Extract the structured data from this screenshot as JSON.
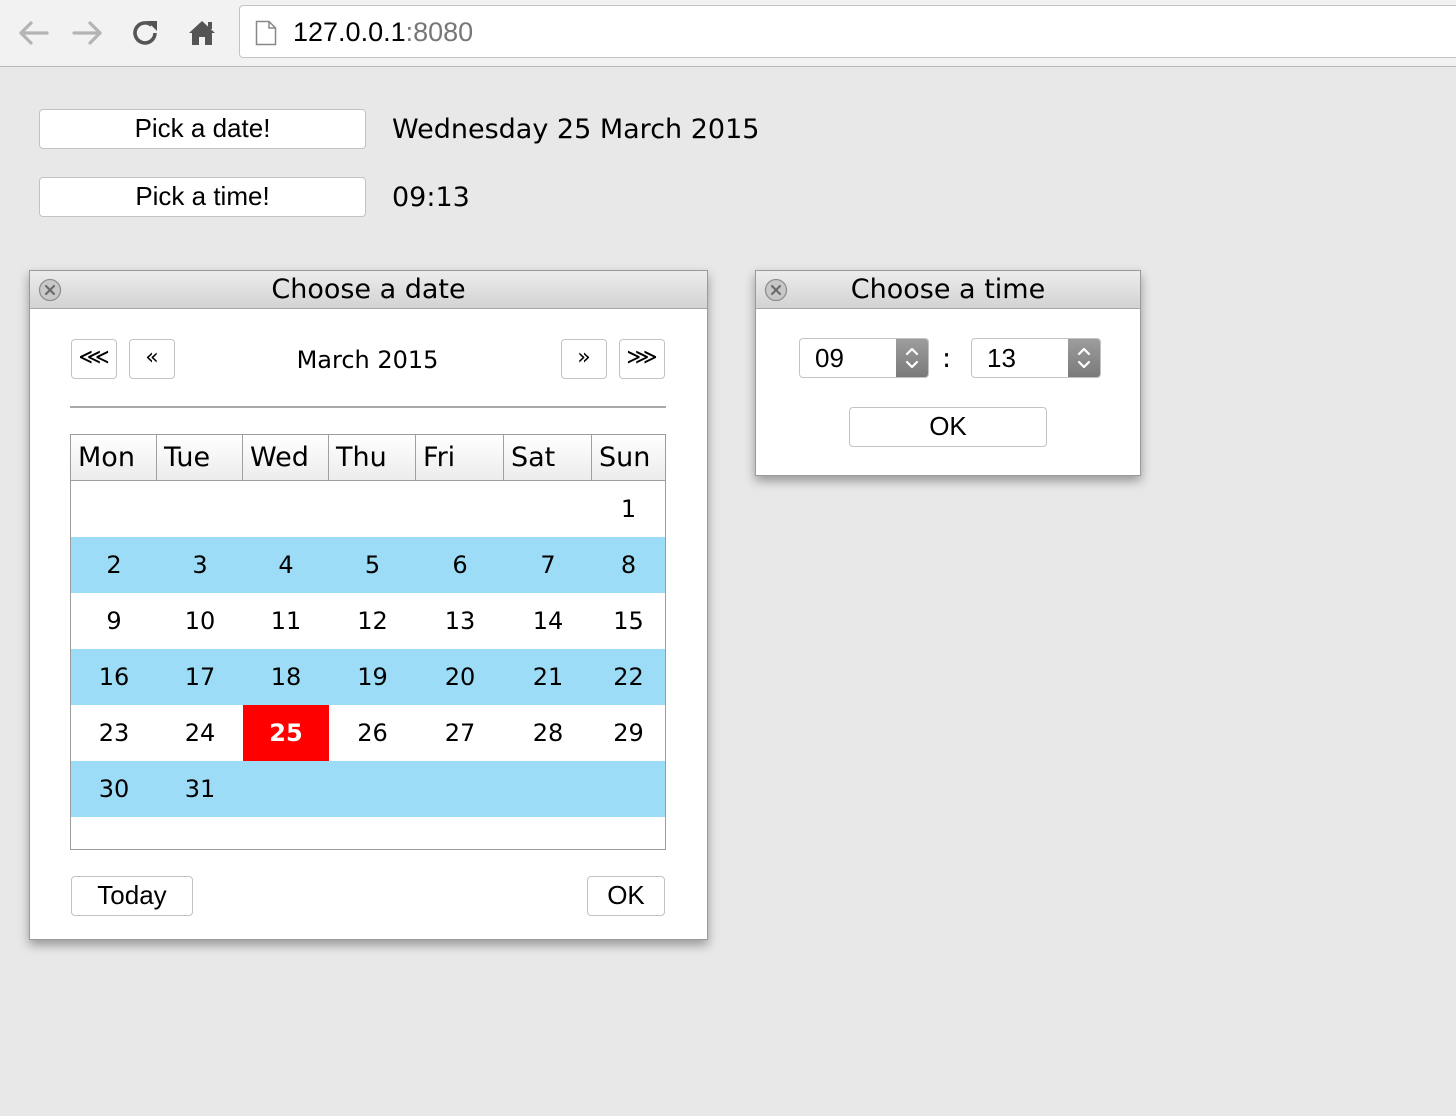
{
  "browser": {
    "url_host": "127.0.0.1",
    "url_port": ":8080",
    "icons": [
      "back-icon",
      "forward-icon",
      "reload-icon",
      "home-icon",
      "page-icon"
    ]
  },
  "page": {
    "date_button_label": "Pick a date!",
    "date_value": "Wednesday 25 March 2015",
    "time_button_label": "Pick a time!",
    "time_value": "09:13"
  },
  "date_dialog": {
    "title": "Choose a date",
    "nav_first_label": "⋘",
    "nav_prev_label": "«",
    "nav_next_label": "»",
    "nav_last_label": "⋙",
    "month_label": "March 2015",
    "weekdays": [
      "Mon",
      "Tue",
      "Wed",
      "Thu",
      "Fri",
      "Sat",
      "Sun"
    ],
    "weeks": [
      [
        "",
        "",
        "",
        "",
        "",
        "",
        "1"
      ],
      [
        "2",
        "3",
        "4",
        "5",
        "6",
        "7",
        "8"
      ],
      [
        "9",
        "10",
        "11",
        "12",
        "13",
        "14",
        "15"
      ],
      [
        "16",
        "17",
        "18",
        "19",
        "20",
        "21",
        "22"
      ],
      [
        "23",
        "24",
        "25",
        "26",
        "27",
        "28",
        "29"
      ],
      [
        "30",
        "31",
        "",
        "",
        "",
        "",
        ""
      ]
    ],
    "selected_day": "25",
    "today_label": "Today",
    "ok_label": "OK",
    "colors": {
      "alt_row": "#9cdcf7",
      "selected": "#ff0000"
    }
  },
  "time_dialog": {
    "title": "Choose a time",
    "hour_value": "09",
    "separator": ":",
    "minute_value": "13",
    "ok_label": "OK"
  }
}
